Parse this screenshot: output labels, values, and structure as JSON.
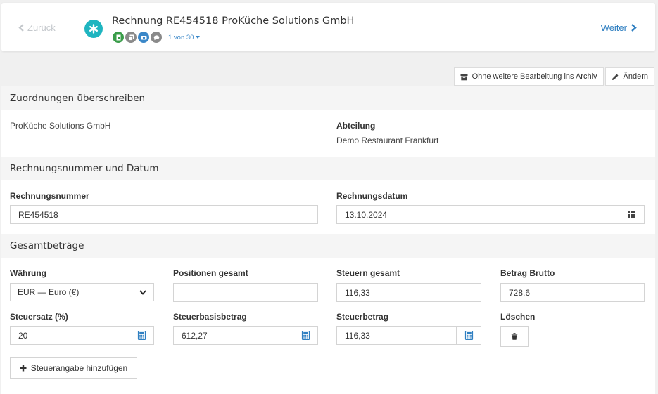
{
  "header": {
    "back_label": "Zurück",
    "title": "Rechnung RE454518 ProKüche Solutions GmbH",
    "pager": "1 von 30",
    "next_label": "Weiter",
    "status_icons": [
      "document-icon",
      "copy-icon",
      "camera-icon",
      "comment-icon"
    ]
  },
  "actions": {
    "archive_label": "Ohne weitere Bearbeitung ins Archiv",
    "edit_label": "Ändern"
  },
  "zuordnungen": {
    "heading": "Zuordnungen überschreiben",
    "supplier": "ProKüche Solutions GmbH",
    "department_label": "Abteilung",
    "department_value": "Demo Restaurant Frankfurt"
  },
  "rechnung": {
    "heading": "Rechnungsnummer und Datum",
    "number_label": "Rechnungsnummer",
    "number_value": "RE454518",
    "date_label": "Rechnungsdatum",
    "date_value": "13.10.2024"
  },
  "gesamt": {
    "heading": "Gesamtbeträge",
    "currency_label": "Währung",
    "currency_value": "EUR — Euro (€)",
    "positions_label": "Positionen gesamt",
    "positions_value": "",
    "taxes_label": "Steuern gesamt",
    "taxes_value": "116,33",
    "gross_label": "Betrag Brutto",
    "gross_value": "728,6",
    "rate_label": "Steuersatz (%)",
    "rate_value": "20",
    "base_label": "Steuerbasisbetrag",
    "base_value": "612,27",
    "tax_amount_label": "Steuerbetrag",
    "tax_amount_value": "116,33",
    "delete_label": "Löschen",
    "add_tax_label": "Steuerangabe hinzufügen"
  },
  "colors": {
    "accent": "#1fb5c0",
    "link": "#2f7fc1",
    "status_green": "#3a9d4a",
    "status_gray": "#8a8a8a",
    "status_blue": "#3a87c8"
  }
}
